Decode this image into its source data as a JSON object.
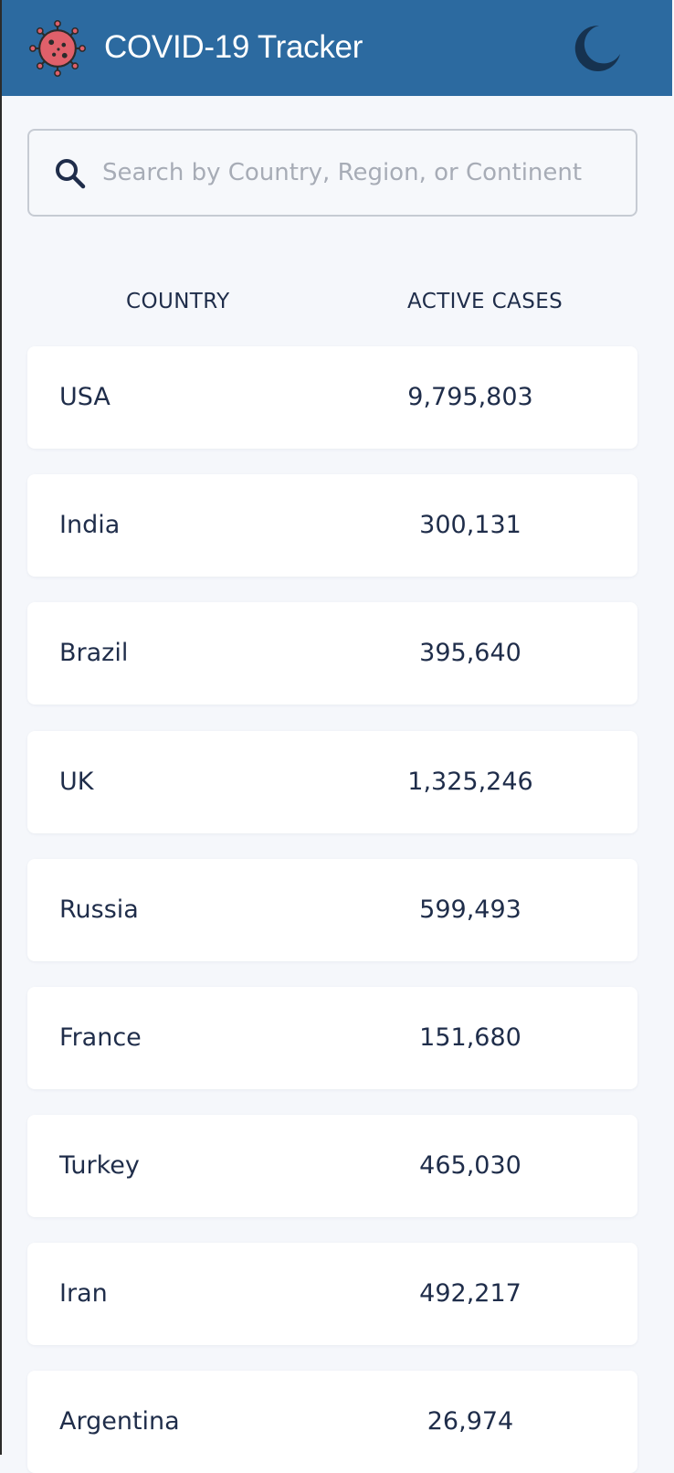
{
  "header": {
    "title": "COVID-19 Tracker",
    "logo_icon": "virus-icon",
    "theme_toggle_icon": "moon-icon",
    "colors": {
      "header_bg": "#2c6aa0",
      "virus_body": "#e0606a",
      "moon": "#16324f"
    }
  },
  "search": {
    "placeholder": "Search by Country, Region, or Continent",
    "value": "",
    "icon": "search-icon"
  },
  "table": {
    "columns": [
      "COUNTRY",
      "ACTIVE CASES"
    ],
    "rows": [
      {
        "country": "USA",
        "active_cases": "9,795,803"
      },
      {
        "country": "India",
        "active_cases": "300,131"
      },
      {
        "country": "Brazil",
        "active_cases": "395,640"
      },
      {
        "country": "UK",
        "active_cases": "1,325,246"
      },
      {
        "country": "Russia",
        "active_cases": "599,493"
      },
      {
        "country": "France",
        "active_cases": "151,680"
      },
      {
        "country": "Turkey",
        "active_cases": "465,030"
      },
      {
        "country": "Iran",
        "active_cases": "492,217"
      },
      {
        "country": "Argentina",
        "active_cases": "26,974"
      }
    ]
  }
}
